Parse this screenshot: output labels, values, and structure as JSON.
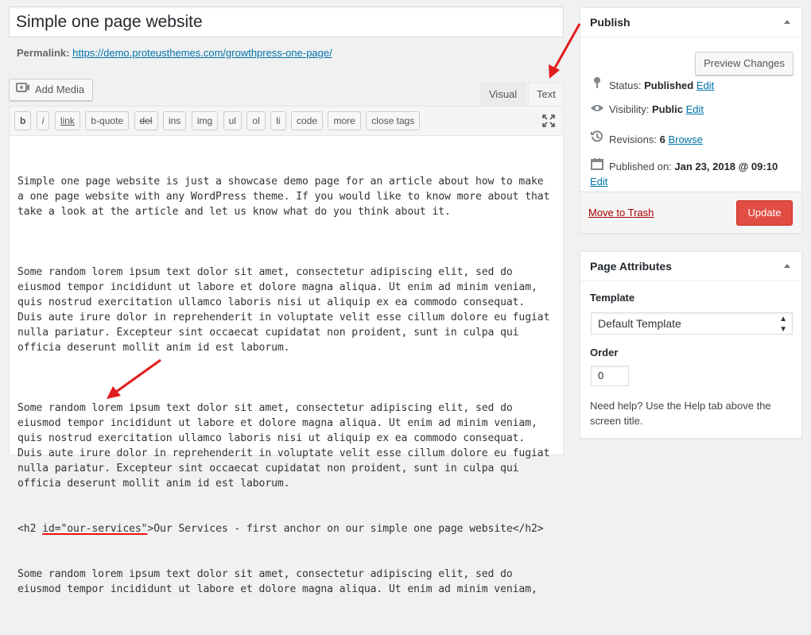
{
  "editor": {
    "title": "Simple one page website",
    "permalink_label": "Permalink:",
    "permalink_url": "https://demo.proteusthemes.com/growthpress-one-page/",
    "add_media_label": "Add Media",
    "tabs": {
      "visual": "Visual",
      "text": "Text"
    },
    "quicktags": [
      "b",
      "i",
      "link",
      "b-quote",
      "del",
      "ins",
      "img",
      "ul",
      "ol",
      "li",
      "code",
      "more",
      "close tags"
    ],
    "content": {
      "p1": [
        "Simple one page website is just a showcase demo page for an article about how to make",
        "a one page website with any WordPress theme. If you would like to know more about that",
        "take a look at the article and let us know what do you think about it."
      ],
      "p2": [
        "Some random lorem ipsum text dolor sit amet, consectetur adipiscing elit, sed do",
        "eiusmod tempor incididunt ut labore et dolore magna aliqua. Ut enim ad minim veniam,",
        "quis nostrud exercitation ullamco laboris nisi ut aliquip ex ea commodo consequat.",
        "Duis aute irure dolor in reprehenderit in voluptate velit esse cillum dolore eu fugiat",
        "nulla pariatur. Excepteur sint occaecat cupidatat non proident, sunt in culpa qui",
        "officia deserunt mollit anim id est laborum."
      ],
      "p3": [
        "Some random lorem ipsum text dolor sit amet, consectetur adipiscing elit, sed do",
        "eiusmod tempor incididunt ut labore et dolore magna aliqua. Ut enim ad minim veniam,",
        "quis nostrud exercitation ullamco laboris nisi ut aliquip ex ea commodo consequat.",
        "Duis aute irure dolor in reprehenderit in voluptate velit esse cillum dolore eu fugiat",
        "nulla pariatur. Excepteur sint occaecat cupidatat non proident, sunt in culpa qui",
        "officia deserunt mollit anim id est laborum."
      ],
      "h2_prefix": "<h2 ",
      "h2_attr": "id=\"our-services\"",
      "h2_rest": ">Our Services - first anchor on our simple one page website</h2>",
      "p4": [
        "Some random lorem ipsum text dolor sit amet, consectetur adipiscing elit, sed do",
        "eiusmod tempor incididunt ut labore et dolore magna aliqua. Ut enim ad minim veniam,"
      ]
    }
  },
  "publish": {
    "title": "Publish",
    "preview_label": "Preview Changes",
    "status_label": "Status:",
    "status_value": "Published",
    "visibility_label": "Visibility:",
    "visibility_value": "Public",
    "revisions_label": "Revisions:",
    "revisions_value": "6",
    "published_label": "Published on:",
    "published_value": "Jan 23, 2018 @ 09:10",
    "edit_label": "Edit",
    "browse_label": "Browse",
    "trash_label": "Move to Trash",
    "update_label": "Update"
  },
  "attributes": {
    "title": "Page Attributes",
    "template_label": "Template",
    "template_value": "Default Template",
    "order_label": "Order",
    "order_value": "0",
    "help_text": "Need help? Use the Help tab above the screen title."
  },
  "colors": {
    "link": "#0073aa",
    "update_button": "#e14d43",
    "annotation_arrow": "#e11d1d",
    "trash": "#a00000"
  },
  "icons": {
    "add_media": "media-camera-icon",
    "fullscreen": "fullscreen-icon",
    "status": "pin-icon",
    "visibility": "eye-icon",
    "revisions": "history-icon",
    "published": "calendar-icon"
  }
}
